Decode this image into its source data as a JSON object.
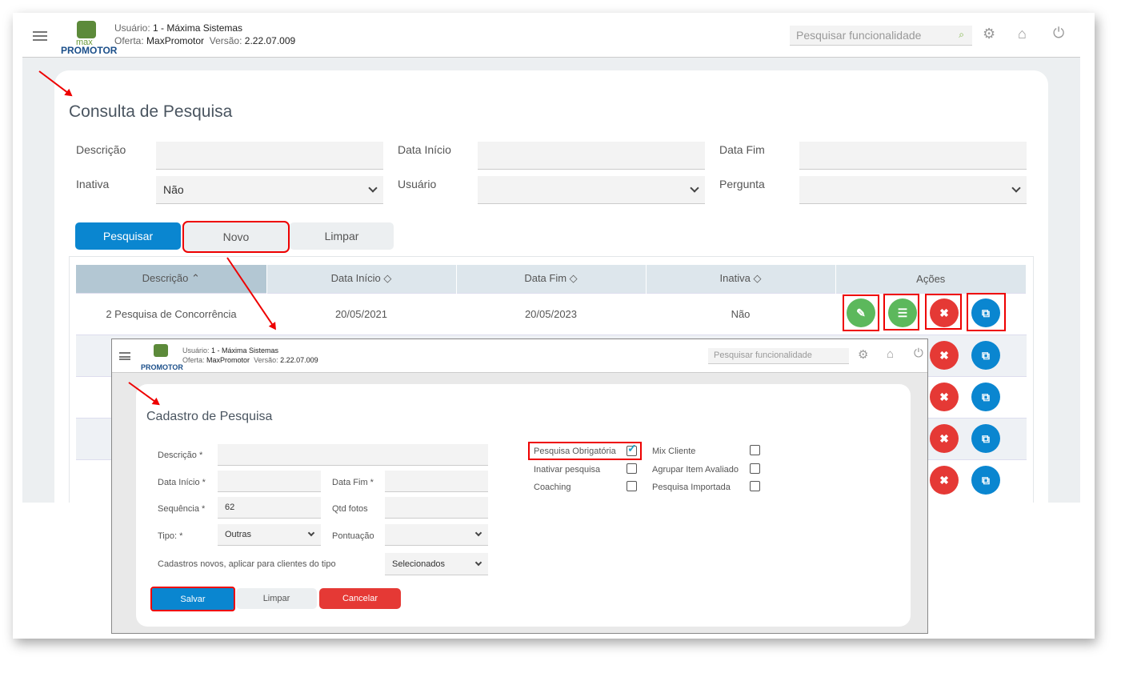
{
  "header": {
    "user_label": "Usuário:",
    "user": "1 - Máxima Sistemas",
    "offer_label": "Oferta:",
    "offer": "MaxPromotor",
    "version_label": "Versão:",
    "version": "2.22.07.009",
    "logo_top": "max",
    "logo_bottom": "PROMOTOR",
    "search_placeholder": "Pesquisar funcionalidade"
  },
  "consulta": {
    "title": "Consulta de Pesquisa",
    "filters": {
      "descricao": "Descrição",
      "data_inicio": "Data Início",
      "data_fim": "Data Fim",
      "inativa": "Inativa",
      "inativa_value": "Não",
      "usuario": "Usuário",
      "pergunta": "Pergunta"
    },
    "buttons": {
      "pesquisar": "Pesquisar",
      "novo": "Novo",
      "limpar": "Limpar"
    },
    "table": {
      "headers": [
        "Descrição",
        "Data Início",
        "Data Fim",
        "Inativa",
        "Ações"
      ],
      "rows": [
        {
          "descricao": "2 Pesquisa de Concorrência",
          "data_inicio": "20/05/2021",
          "data_fim": "20/05/2023",
          "inativa": "Não"
        }
      ]
    }
  },
  "cadastro": {
    "title": "Cadastro de Pesquisa",
    "labels": {
      "descricao": "Descrição *",
      "data_inicio": "Data Início *",
      "data_fim": "Data Fim *",
      "sequencia": "Sequência *",
      "qtd_fotos": "Qtd fotos",
      "tipo": "Tipo: *",
      "pontuacao": "Pontuação",
      "cadastros": "Cadastros novos, aplicar para clientes do tipo"
    },
    "values": {
      "sequencia": "62",
      "tipo": "Outras",
      "cadastros": "Selecionados"
    },
    "checkboxes": [
      {
        "label": "Pesquisa Obrigatória",
        "checked": true
      },
      {
        "label": "Inativar pesquisa",
        "checked": false
      },
      {
        "label": "Coaching",
        "checked": false
      },
      {
        "label": "Mix Cliente",
        "checked": false
      },
      {
        "label": "Agrupar Item Avaliado",
        "checked": false
      },
      {
        "label": "Pesquisa Importada",
        "checked": false
      }
    ],
    "buttons": {
      "salvar": "Salvar",
      "limpar": "Limpar",
      "cancelar": "Cancelar"
    }
  },
  "colors": {
    "primary": "#0a86d0",
    "success": "#5cb85c",
    "danger": "#e53935",
    "highlight": "#ee0000"
  }
}
